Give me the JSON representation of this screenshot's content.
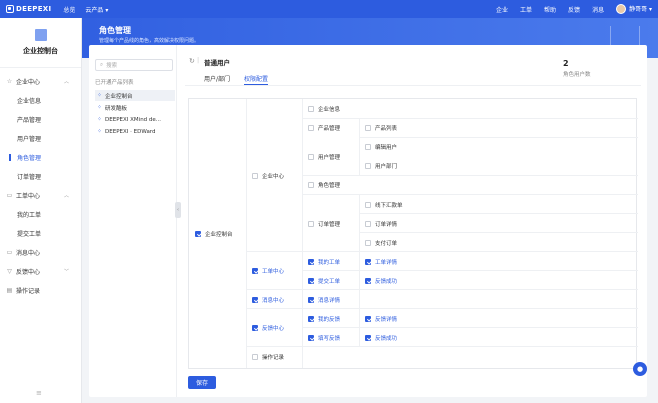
{
  "topbar": {
    "brand": "DEEPEXI",
    "nav": [
      "总览",
      "云产品 ▾"
    ],
    "right": [
      "企业",
      "工单",
      "帮助",
      "反馈",
      "消息"
    ],
    "user": "静哥哥 ▾"
  },
  "hero": {
    "title": "角色管理",
    "subtitle": "管理每个产品线的角色，高效解决权限问题。"
  },
  "sidebar": {
    "title": "企业控制台",
    "groups": [
      {
        "icon": "☆",
        "label": "企业中心",
        "chev": "︿",
        "items": [
          "企业信息",
          "产品管理",
          "用户管理",
          "角色管理",
          "订单管理"
        ]
      },
      {
        "icon": "▭",
        "label": "工单中心",
        "chev": "︿",
        "items": [
          "我的工单",
          "提交工单"
        ]
      },
      {
        "icon": "▭",
        "label": "消息中心",
        "chev": "",
        "items": []
      },
      {
        "icon": "▽",
        "label": "反馈中心",
        "chev": "﹀",
        "items": []
      },
      {
        "icon": "▤",
        "label": "操作记录",
        "chev": "",
        "items": []
      }
    ],
    "active": "角色管理",
    "footer": "≡"
  },
  "tree": {
    "search_placeholder": "搜索",
    "caption": "已开通产品列表",
    "nodes": [
      "企业控制台",
      "研发酷板",
      "DEEPEXI XMind de...",
      "DEEPEXI · EDWard"
    ]
  },
  "role": {
    "back": "↻",
    "name": "普通用户",
    "tabs": [
      "用户/部门",
      "权限配置"
    ],
    "active_tab": "权限配置",
    "count": "2",
    "count_label": "角色用户数"
  },
  "perm": {
    "root": "企业控制台",
    "l2": [
      "企业中心",
      "工单中心",
      "消息中心",
      "反馈中心",
      "操作记录"
    ],
    "l3": [
      "企业信息",
      "产品管理",
      "用户管理",
      "角色管理",
      "订单管理",
      "我的工单",
      "提交工单",
      "消息详情",
      "我的反馈",
      "填写反馈"
    ],
    "l4": [
      "产品列表",
      "编辑用户",
      "用户部门",
      "线下汇款单",
      "订单详情",
      "支付订单",
      "工单详情",
      "反馈成功",
      "反馈详情",
      "反馈成功"
    ]
  },
  "save_label": "保存",
  "chat_icon": "●",
  "colors": {
    "accent": "#2d5cdf"
  }
}
